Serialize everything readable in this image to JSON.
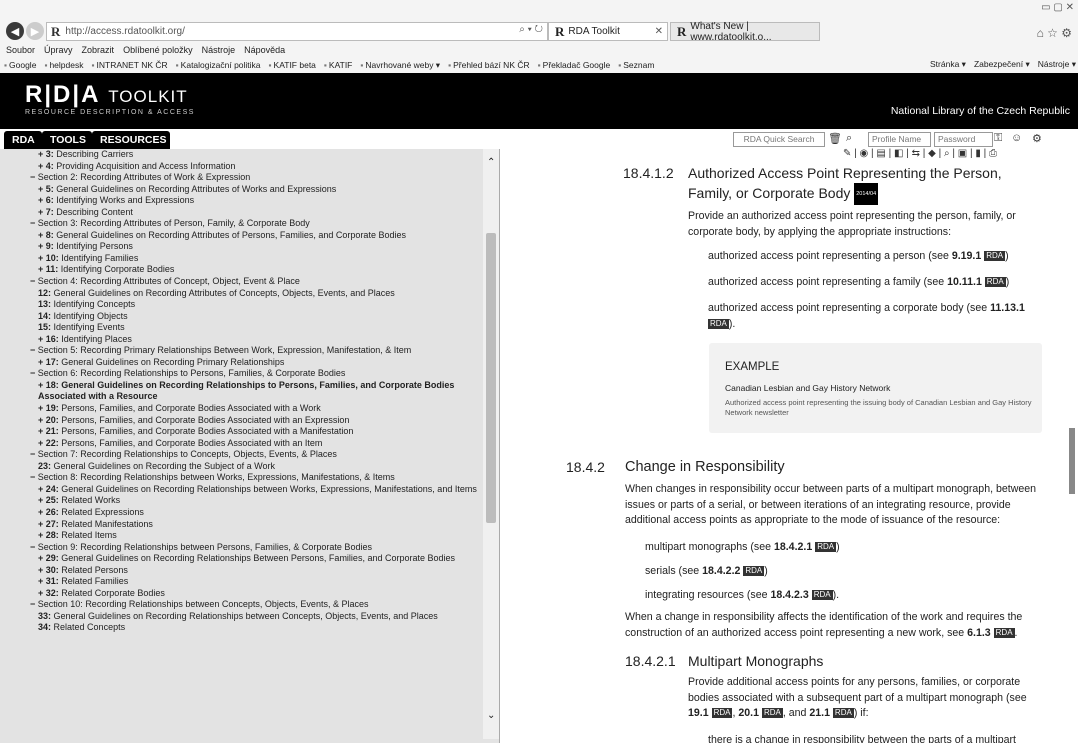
{
  "browser": {
    "url": "http://access.rdatoolkit.org/",
    "address_tools": "⌕ ▾ ↻",
    "tabs": [
      {
        "label": "RDA Toolkit",
        "active": true
      },
      {
        "label": "What's New | www.rdatoolkit.o...",
        "active": false
      }
    ],
    "menu": [
      "Soubor",
      "Úpravy",
      "Zobrazit",
      "Oblíbené položky",
      "Nástroje",
      "Nápověda"
    ],
    "favorites": [
      "Google",
      "helpdesk",
      "INTRANET NK ČR",
      "Katalogizační politika",
      "KATIF beta",
      "KATIF",
      "Navrhované weby ▾",
      "Přehled bází NK ČR",
      "Překladač Google",
      "Seznam"
    ],
    "favorites_right": [
      "Stránka ▾",
      "Zabezpečení ▾",
      "Nástroje ▾"
    ]
  },
  "header": {
    "logo_rda": "R|D|A",
    "logo_toolkit": "TOOLKIT",
    "logo_sub": "RESOURCE DESCRIPTION & ACCESS",
    "institution": "National Library of the Czech Republic"
  },
  "sidebar": {
    "tabs": [
      "RDA",
      "TOOLS",
      "RESOURCES"
    ],
    "toc": [
      {
        "prefix": "+ 3:",
        "text": "Describing Carriers",
        "cls": "lv1"
      },
      {
        "prefix": "+ 4:",
        "text": "Providing Acquisition and Access Information",
        "cls": "lv1"
      },
      {
        "prefix": "−",
        "text": "Section 2: Recording Attributes of Work & Expression",
        "cls": "lv0"
      },
      {
        "prefix": "+ 5:",
        "text": "General Guidelines on Recording Attributes of Works and Expressions",
        "cls": "lv1"
      },
      {
        "prefix": "+ 6:",
        "text": "Identifying Works and Expressions",
        "cls": "lv1"
      },
      {
        "prefix": "+ 7:",
        "text": "Describing Content",
        "cls": "lv1"
      },
      {
        "prefix": "−",
        "text": "Section 3: Recording Attributes of Person, Family, & Corporate Body",
        "cls": "lv0"
      },
      {
        "prefix": "+ 8:",
        "text": "General Guidelines on Recording Attributes of Persons, Families, and Corporate Bodies",
        "cls": "lv1"
      },
      {
        "prefix": "+ 9:",
        "text": "Identifying Persons",
        "cls": "lv1"
      },
      {
        "prefix": "+ 10:",
        "text": "Identifying Families",
        "cls": "lv1"
      },
      {
        "prefix": "+ 11:",
        "text": "Identifying Corporate Bodies",
        "cls": "lv1"
      },
      {
        "prefix": "−",
        "text": "Section 4: Recording Attributes of Concept, Object, Event & Place",
        "cls": "lv0"
      },
      {
        "prefix": "12:",
        "text": "General Guidelines on Recording Attributes of Concepts, Objects, Events, and Places",
        "cls": "lv2"
      },
      {
        "prefix": "13:",
        "text": "Identifying Concepts",
        "cls": "lv2"
      },
      {
        "prefix": "14:",
        "text": "Identifying Objects",
        "cls": "lv2"
      },
      {
        "prefix": "15:",
        "text": "Identifying Events",
        "cls": "lv2"
      },
      {
        "prefix": "+ 16:",
        "text": "Identifying Places",
        "cls": "lv1"
      },
      {
        "prefix": "−",
        "text": "Section 5: Recording Primary Relationships Between Work, Expression, Manifestation, & Item",
        "cls": "lv0"
      },
      {
        "prefix": "+ 17:",
        "text": "General Guidelines on Recording Primary Relationships",
        "cls": "lv1"
      },
      {
        "prefix": "−",
        "text": "Section 6: Recording Relationships to Persons, Families, & Corporate Bodies",
        "cls": "lv0"
      },
      {
        "prefix": "+ 18:",
        "text": "General Guidelines on Recording Relationships to Persons, Families, and Corporate Bodies Associated with a Resource",
        "cls": "lv1 bold"
      },
      {
        "prefix": "+ 19:",
        "text": "Persons, Families, and Corporate Bodies Associated with a Work",
        "cls": "lv1"
      },
      {
        "prefix": "+ 20:",
        "text": "Persons, Families, and Corporate Bodies Associated with an Expression",
        "cls": "lv1"
      },
      {
        "prefix": "+ 21:",
        "text": "Persons, Families, and Corporate Bodies Associated with a Manifestation",
        "cls": "lv1"
      },
      {
        "prefix": "+ 22:",
        "text": "Persons, Families, and Corporate Bodies Associated with an Item",
        "cls": "lv1"
      },
      {
        "prefix": "−",
        "text": "Section 7: Recording Relationships to Concepts, Objects, Events, & Places",
        "cls": "lv0"
      },
      {
        "prefix": "23:",
        "text": "General Guidelines on Recording the Subject of a Work",
        "cls": "lv2"
      },
      {
        "prefix": "−",
        "text": "Section 8: Recording Relationships between Works, Expressions, Manifestations, & Items",
        "cls": "lv0"
      },
      {
        "prefix": "+ 24:",
        "text": "General Guidelines on Recording Relationships between Works, Expressions, Manifestations, and Items",
        "cls": "lv1"
      },
      {
        "prefix": "+ 25:",
        "text": "Related Works",
        "cls": "lv1"
      },
      {
        "prefix": "+ 26:",
        "text": "Related Expressions",
        "cls": "lv1"
      },
      {
        "prefix": "+ 27:",
        "text": "Related Manifestations",
        "cls": "lv1"
      },
      {
        "prefix": "+ 28:",
        "text": "Related Items",
        "cls": "lv1"
      },
      {
        "prefix": "−",
        "text": "Section 9: Recording Relationships between Persons, Families, & Corporate Bodies",
        "cls": "lv0"
      },
      {
        "prefix": "+ 29:",
        "text": "General Guidelines on Recording Relationships Between Persons, Families, and Corporate Bodies",
        "cls": "lv1"
      },
      {
        "prefix": "+ 30:",
        "text": "Related Persons",
        "cls": "lv1"
      },
      {
        "prefix": "+ 31:",
        "text": "Related Families",
        "cls": "lv1"
      },
      {
        "prefix": "+ 32:",
        "text": "Related Corporate Bodies",
        "cls": "lv1"
      },
      {
        "prefix": "−",
        "text": "Section 10: Recording Relationships between Concepts, Objects, Events, & Places",
        "cls": "lv0"
      },
      {
        "prefix": "33:",
        "text": "General Guidelines on Recording Relationships between Concepts, Objects, Events, and Places",
        "cls": "lv2"
      },
      {
        "prefix": "34:",
        "text": "Related Concepts",
        "cls": "lv2"
      }
    ]
  },
  "toolbar": {
    "quick_search": "RDA Quick Search",
    "profile_name": "Profile Name",
    "password": "Password"
  },
  "content": {
    "s1_num": "18.4.1.2",
    "s1_title_a": "Authorized Access Point Representing the Person,",
    "s1_title_b": "Family, or Corporate Body",
    "s1_badge": "2014/04",
    "s1_intro": "Provide an authorized access point representing the person, family, or corporate body, by applying the appropriate instructions:",
    "s1_item1": "authorized access point representing a person (see ",
    "s1_item1_ref": "9.19.1",
    "s1_item2": "authorized access point representing a family (see ",
    "s1_item2_ref": "10.11.1",
    "s1_item3": "authorized access point representing a corporate body (see ",
    "s1_item3_ref": "11.13.1",
    "rda": "RDA",
    "example_label": "EXAMPLE",
    "example_l1": "Canadian Lesbian and Gay History Network",
    "example_l2_a": "Authorized access point representing the issuing body of",
    "example_l2_b": "Canadian Lesbian and Gay History Network newsletter",
    "s2_num": "18.4.2",
    "s2_title": "Change in Responsibility",
    "s2_p1": "When changes in responsibility occur between parts of a multipart monograph, between issues or parts of a serial, or between iterations of an integrating resource, provide additional access points as appropriate to the mode of issuance of the resource:",
    "s2_i1": "multipart monographs (see ",
    "s2_i1_ref": "18.4.2.1",
    "s2_i2": "serials (see ",
    "s2_i2_ref": "18.4.2.2",
    "s2_i3": "integrating resources (see ",
    "s2_i3_ref": "18.4.2.3",
    "s2_p2": "When a change in responsibility affects the identification of the work and requires the construction of an authorized access point representing a new work, see ",
    "s2_p2_ref": "6.1.3",
    "s3_num": "18.4.2.1",
    "s3_title": "Multipart Monographs",
    "s3_p1": "Provide additional access points for any persons, families, or corporate bodies associated with a subsequent part of a multipart monograph (see ",
    "s3_ref1": "19.1",
    "s3_ref2": "20.1",
    "s3_ref3": "21.1",
    "s3_p2": "there is a change in responsibility between the parts of a multipart"
  }
}
